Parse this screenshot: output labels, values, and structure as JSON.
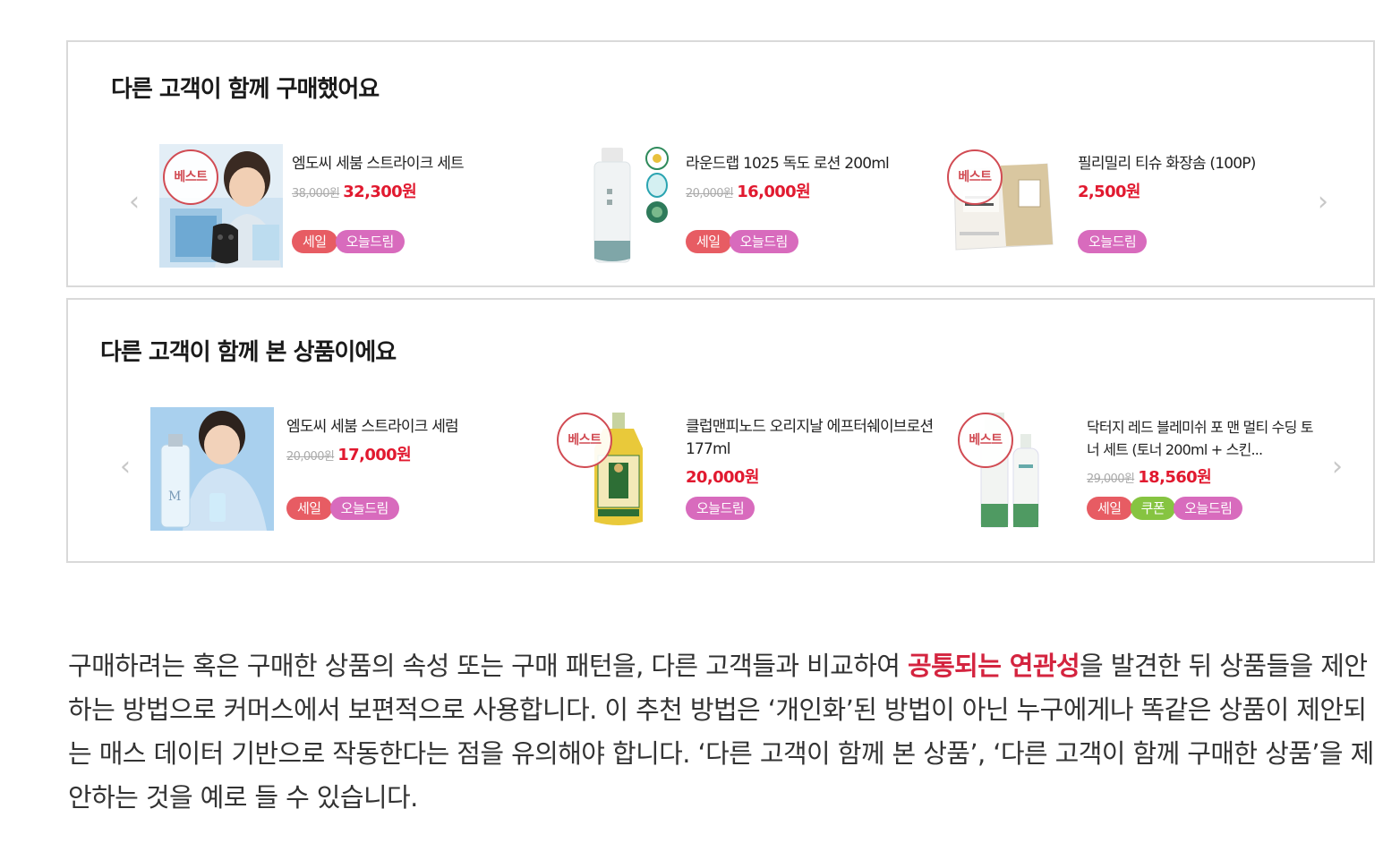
{
  "section1": {
    "title": "다른 고객이 함께 구매했어요",
    "products": [
      {
        "name": "엠도씨 세붐 스트라이크 세트",
        "orig_price": "38,000원",
        "price": "32,300원",
        "best": "베스트",
        "tags": [
          "세일",
          "오늘드림"
        ]
      },
      {
        "name": "라운드랩 1025 독도 로션 200ml",
        "orig_price": "20,000원",
        "price": "16,000원",
        "best": "",
        "tags": [
          "세일",
          "오늘드림"
        ]
      },
      {
        "name": "필리밀리 티슈 화장솜 (100P)",
        "orig_price": "",
        "price": "2,500원",
        "best": "베스트",
        "tags": [
          "오늘드림"
        ]
      }
    ]
  },
  "section2": {
    "title": "다른 고객이 함께 본 상품이에요",
    "products": [
      {
        "name": "엠도씨 세붐 스트라이크 세럼",
        "orig_price": "20,000원",
        "price": "17,000원",
        "best": "",
        "tags": [
          "세일",
          "오늘드림"
        ]
      },
      {
        "name": "클럽맨피노드 오리지날 에프터쉐이브로션 177ml",
        "orig_price": "",
        "price": "20,000원",
        "best": "베스트",
        "tags": [
          "오늘드림"
        ]
      },
      {
        "name": "닥터지 레드 블레미쉬 포 맨 멀티 수딩 토너 세트 (토너 200ml + 스킨...",
        "orig_price": "29,000원",
        "price": "18,560원",
        "best": "베스트",
        "tags": [
          "세일",
          "쿠폰",
          "오늘드림"
        ]
      }
    ]
  },
  "arrows": {
    "prev": "‹",
    "next": "›"
  },
  "description": {
    "part1": "구매하려는 혹은 구매한 상품의 속성 또는 구매 패턴을, 다른 고객들과 비교하여 ",
    "highlight": "공통되는 연관성",
    "part2": "을 발견한 뒤 상품들을 제안하는 방법으로 커머스에서 보편적으로 사용합니다. 이 추천 방법은 ‘개인화’된 방법이 아닌 누구에게나 똑같은 상품이 제안되는 매스 데이터 기반으로 작동한다는 점을 유의해야 합니다. ‘다른 고객이 함께 본 상품’, ‘다른 고객이 함께 구매한 상품’을 제안하는 것을 예로 들 수 있습니다."
  },
  "colors": {
    "price": "#e1192f",
    "sale": "#e75c63",
    "dream": "#d86bbd",
    "coupon": "#86c441",
    "highlight": "#d4243f"
  }
}
